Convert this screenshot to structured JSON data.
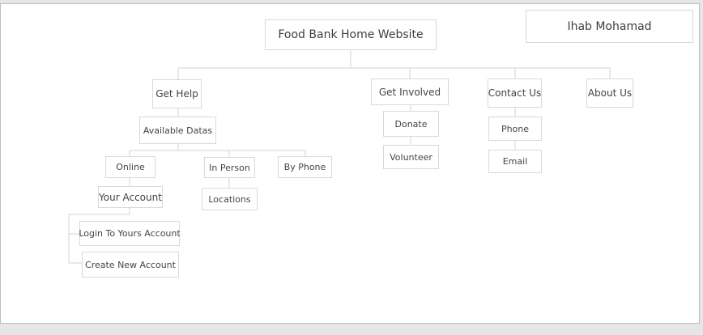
{
  "author": "Ihab Mohamad",
  "root": "Food Bank Home Website",
  "nodes": {
    "get_help": "Get Help",
    "available_datas": "Available Datas",
    "online": "Online",
    "in_person": "In Person",
    "by_phone": "By Phone",
    "your_account": "Your Account",
    "locations": "Locations",
    "login": "Login To Yours Account",
    "create_account": "Create New Account",
    "get_involved": "Get Involved",
    "donate": "Donate",
    "volunteer": "Volunteer",
    "contact_us": "Contact Us",
    "phone": "Phone",
    "email": "Email",
    "about_us": "About Us"
  },
  "colors": {
    "border": "#d9d9d9",
    "connector": "#d3d3d3",
    "text": "#444444",
    "background": "#ffffff"
  }
}
